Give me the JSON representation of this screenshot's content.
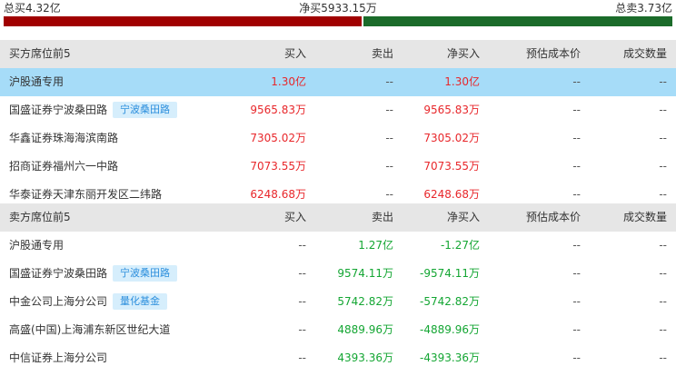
{
  "colors": {
    "buy_bar": "#a00000",
    "sell_bar": "#1b6b2a",
    "red": "#e8272b",
    "green": "#14a633",
    "header_bg": "#e6e6e6",
    "highlight_bg": "#a6dcf8",
    "tag_bg": "#d6eefc",
    "tag_text": "#2d8fdd"
  },
  "summary": {
    "total_buy": "总买4.32亿",
    "net_buy": "净买5933.15万",
    "total_sell": "总卖3.73亿",
    "buy_share": 0.537
  },
  "buy_table": {
    "headers": [
      "买方席位前5",
      "买入",
      "卖出",
      "净买入",
      "预估成本价",
      "成交数量"
    ],
    "rows": [
      {
        "name": "沪股通专用",
        "tag": "",
        "buy": "1.30亿",
        "sell": "--",
        "net": "1.30亿",
        "cost": "--",
        "volume": "--",
        "highlight": true
      },
      {
        "name": "国盛证券宁波桑田路",
        "tag": "宁波桑田路",
        "buy": "9565.83万",
        "sell": "--",
        "net": "9565.83万",
        "cost": "--",
        "volume": "--",
        "highlight": false
      },
      {
        "name": "华鑫证券珠海海滨南路",
        "tag": "",
        "buy": "7305.02万",
        "sell": "--",
        "net": "7305.02万",
        "cost": "--",
        "volume": "--",
        "highlight": false
      },
      {
        "name": "招商证券福州六一中路",
        "tag": "",
        "buy": "7073.55万",
        "sell": "--",
        "net": "7073.55万",
        "cost": "--",
        "volume": "--",
        "highlight": false
      },
      {
        "name": "华泰证券天津东丽开发区二纬路",
        "tag": "",
        "buy": "6248.68万",
        "sell": "--",
        "net": "6248.68万",
        "cost": "--",
        "volume": "--",
        "highlight": false
      }
    ]
  },
  "sell_table": {
    "headers": [
      "卖方席位前5",
      "买入",
      "卖出",
      "净买入",
      "预估成本价",
      "成交数量"
    ],
    "rows": [
      {
        "name": "沪股通专用",
        "tag": "",
        "buy": "--",
        "sell": "1.27亿",
        "net": "-1.27亿",
        "cost": "--",
        "volume": "--"
      },
      {
        "name": "国盛证券宁波桑田路",
        "tag": "宁波桑田路",
        "buy": "--",
        "sell": "9574.11万",
        "net": "-9574.11万",
        "cost": "--",
        "volume": "--"
      },
      {
        "name": "中金公司上海分公司",
        "tag": "量化基金",
        "buy": "--",
        "sell": "5742.82万",
        "net": "-5742.82万",
        "cost": "--",
        "volume": "--"
      },
      {
        "name": "高盛(中国)上海浦东新区世纪大道",
        "tag": "",
        "buy": "--",
        "sell": "4889.96万",
        "net": "-4889.96万",
        "cost": "--",
        "volume": "--"
      },
      {
        "name": "中信证券上海分公司",
        "tag": "",
        "buy": "--",
        "sell": "4393.36万",
        "net": "-4393.36万",
        "cost": "--",
        "volume": "--"
      }
    ]
  }
}
